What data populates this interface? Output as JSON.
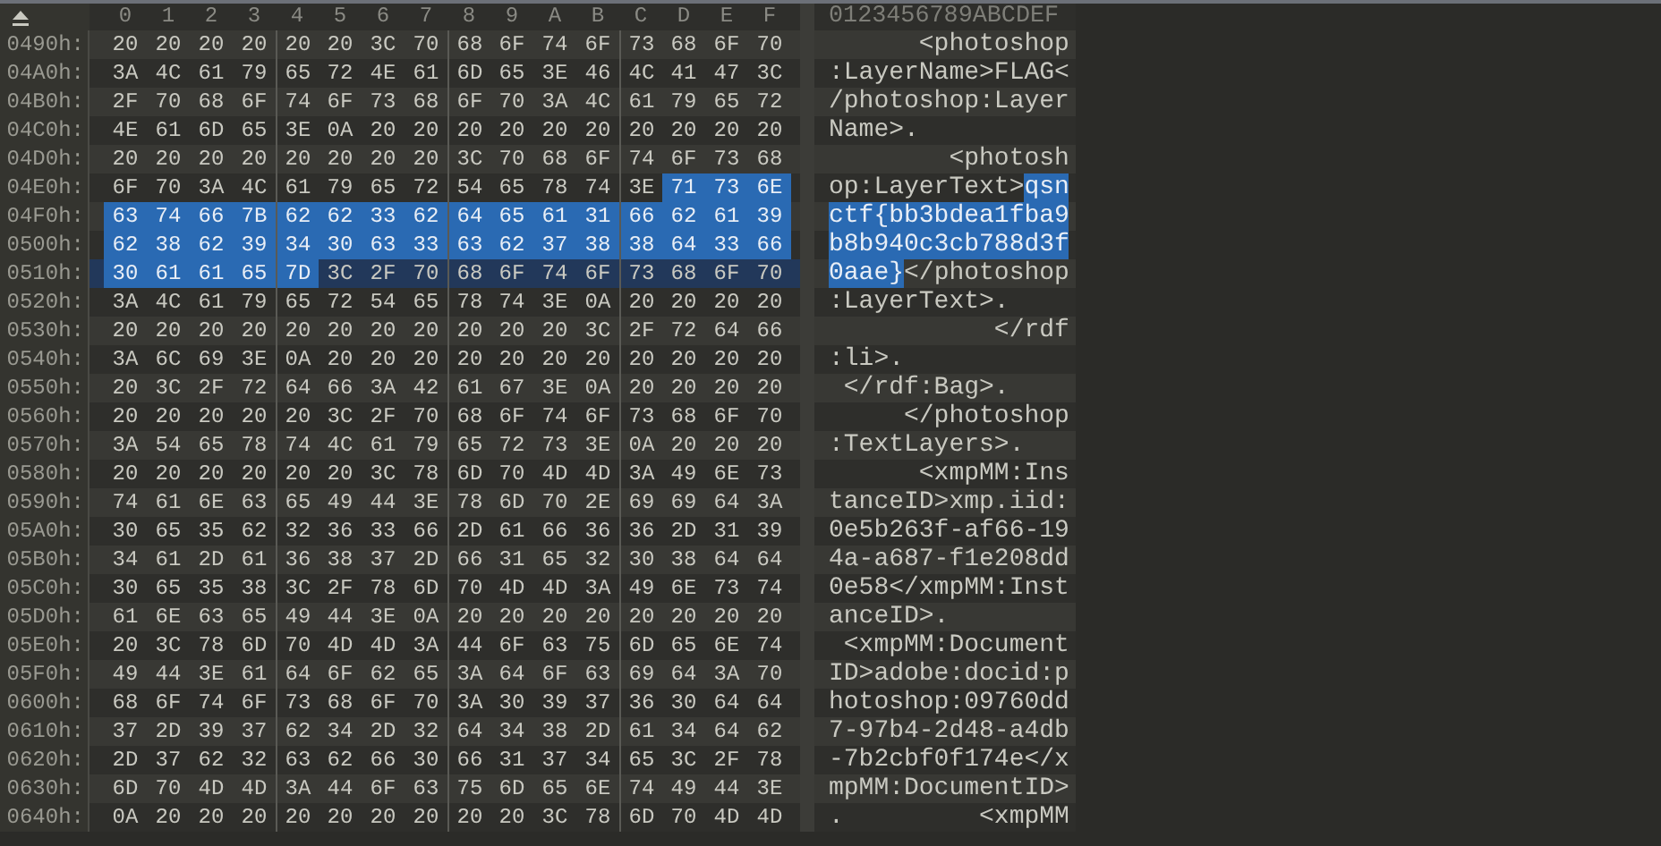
{
  "header": {
    "hex_columns": [
      "0",
      "1",
      "2",
      "3",
      "4",
      "5",
      "6",
      "7",
      "8",
      "9",
      "A",
      "B",
      "C",
      "D",
      "E",
      "F"
    ],
    "ascii_ruler": "0123456789ABCDEF"
  },
  "rows": [
    {
      "offset": "0490h:",
      "current": false,
      "hex": [
        {
          "bytes": "20 20 20 20 20 20 3C 70 68 6F 74 6F 73 68 6F 70",
          "selected": false
        }
      ],
      "ascii": [
        {
          "text": "      <photoshop",
          "selected": false
        }
      ]
    },
    {
      "offset": "04A0h:",
      "current": false,
      "hex": [
        {
          "bytes": "3A 4C 61 79 65 72 4E 61 6D 65 3E 46 4C 41 47 3C",
          "selected": false
        }
      ],
      "ascii": [
        {
          "text": ":LayerName>FLAG<",
          "selected": false
        }
      ]
    },
    {
      "offset": "04B0h:",
      "current": false,
      "hex": [
        {
          "bytes": "2F 70 68 6F 74 6F 73 68 6F 70 3A 4C 61 79 65 72",
          "selected": false
        }
      ],
      "ascii": [
        {
          "text": "/photoshop:Layer",
          "selected": false
        }
      ]
    },
    {
      "offset": "04C0h:",
      "current": false,
      "hex": [
        {
          "bytes": "4E 61 6D 65 3E 0A 20 20 20 20 20 20 20 20 20 20",
          "selected": false
        }
      ],
      "ascii": [
        {
          "text": "Name>.",
          "selected": false
        }
      ]
    },
    {
      "offset": "04D0h:",
      "current": false,
      "hex": [
        {
          "bytes": "20 20 20 20 20 20 20 20 3C 70 68 6F 74 6F 73 68",
          "selected": false
        }
      ],
      "ascii": [
        {
          "text": "        <photosh",
          "selected": false
        }
      ]
    },
    {
      "offset": "04E0h:",
      "current": false,
      "hex": [
        {
          "bytes": "6F 70 3A 4C 61 79 65 72 54 65 78 74 3E",
          "selected": false
        },
        {
          "bytes": "71 73 6E",
          "selected": true
        }
      ],
      "ascii": [
        {
          "text": "op:LayerText>",
          "selected": false
        },
        {
          "text": "qsn",
          "selected": true
        }
      ]
    },
    {
      "offset": "04F0h:",
      "current": false,
      "hex": [
        {
          "bytes": "63 74 66 7B 62 62 33 62 64 65 61 31 66 62 61 39",
          "selected": true
        }
      ],
      "ascii": [
        {
          "text": "ctf{bb3bdea1fba9",
          "selected": true
        }
      ]
    },
    {
      "offset": "0500h:",
      "current": false,
      "hex": [
        {
          "bytes": "62 38 62 39 34 30 63 33 63 62 37 38 38 64 33 66",
          "selected": true
        }
      ],
      "ascii": [
        {
          "text": "b8b940c3cb788d3f",
          "selected": true
        }
      ]
    },
    {
      "offset": "0510h:",
      "current": true,
      "hex": [
        {
          "bytes": "30 61 61 65 7D",
          "selected": true
        },
        {
          "bytes": "3C 2F 70 68 6F 74 6F 73 68 6F 70",
          "selected": false
        }
      ],
      "ascii": [
        {
          "text": "0aae}",
          "selected": true
        },
        {
          "text": "</photoshop",
          "selected": false
        }
      ]
    },
    {
      "offset": "0520h:",
      "current": false,
      "hex": [
        {
          "bytes": "3A 4C 61 79 65 72 54 65 78 74 3E 0A 20 20 20 20",
          "selected": false
        }
      ],
      "ascii": [
        {
          "text": ":LayerText>.",
          "selected": false
        }
      ]
    },
    {
      "offset": "0530h:",
      "current": false,
      "hex": [
        {
          "bytes": "20 20 20 20 20 20 20 20 20 20 20 3C 2F 72 64 66",
          "selected": false
        }
      ],
      "ascii": [
        {
          "text": "           </rdf",
          "selected": false
        }
      ]
    },
    {
      "offset": "0540h:",
      "current": false,
      "hex": [
        {
          "bytes": "3A 6C 69 3E 0A 20 20 20 20 20 20 20 20 20 20 20",
          "selected": false
        }
      ],
      "ascii": [
        {
          "text": ":li>.",
          "selected": false
        }
      ]
    },
    {
      "offset": "0550h:",
      "current": false,
      "hex": [
        {
          "bytes": "20 3C 2F 72 64 66 3A 42 61 67 3E 0A 20 20 20 20",
          "selected": false
        }
      ],
      "ascii": [
        {
          "text": " </rdf:Bag>.",
          "selected": false
        }
      ]
    },
    {
      "offset": "0560h:",
      "current": false,
      "hex": [
        {
          "bytes": "20 20 20 20 20 3C 2F 70 68 6F 74 6F 73 68 6F 70",
          "selected": false
        }
      ],
      "ascii": [
        {
          "text": "     </photoshop",
          "selected": false
        }
      ]
    },
    {
      "offset": "0570h:",
      "current": false,
      "hex": [
        {
          "bytes": "3A 54 65 78 74 4C 61 79 65 72 73 3E 0A 20 20 20",
          "selected": false
        }
      ],
      "ascii": [
        {
          "text": ":TextLayers>.",
          "selected": false
        }
      ]
    },
    {
      "offset": "0580h:",
      "current": false,
      "hex": [
        {
          "bytes": "20 20 20 20 20 20 3C 78 6D 70 4D 4D 3A 49 6E 73",
          "selected": false
        }
      ],
      "ascii": [
        {
          "text": "      <xmpMM:Ins",
          "selected": false
        }
      ]
    },
    {
      "offset": "0590h:",
      "current": false,
      "hex": [
        {
          "bytes": "74 61 6E 63 65 49 44 3E 78 6D 70 2E 69 69 64 3A",
          "selected": false
        }
      ],
      "ascii": [
        {
          "text": "tanceID>xmp.iid:",
          "selected": false
        }
      ]
    },
    {
      "offset": "05A0h:",
      "current": false,
      "hex": [
        {
          "bytes": "30 65 35 62 32 36 33 66 2D 61 66 36 36 2D 31 39",
          "selected": false
        }
      ],
      "ascii": [
        {
          "text": "0e5b263f-af66-19",
          "selected": false
        }
      ]
    },
    {
      "offset": "05B0h:",
      "current": false,
      "hex": [
        {
          "bytes": "34 61 2D 61 36 38 37 2D 66 31 65 32 30 38 64 64",
          "selected": false
        }
      ],
      "ascii": [
        {
          "text": "4a-a687-f1e208dd",
          "selected": false
        }
      ]
    },
    {
      "offset": "05C0h:",
      "current": false,
      "hex": [
        {
          "bytes": "30 65 35 38 3C 2F 78 6D 70 4D 4D 3A 49 6E 73 74",
          "selected": false
        }
      ],
      "ascii": [
        {
          "text": "0e58</xmpMM:Inst",
          "selected": false
        }
      ]
    },
    {
      "offset": "05D0h:",
      "current": false,
      "hex": [
        {
          "bytes": "61 6E 63 65 49 44 3E 0A 20 20 20 20 20 20 20 20",
          "selected": false
        }
      ],
      "ascii": [
        {
          "text": "anceID>.",
          "selected": false
        }
      ]
    },
    {
      "offset": "05E0h:",
      "current": false,
      "hex": [
        {
          "bytes": "20 3C 78 6D 70 4D 4D 3A 44 6F 63 75 6D 65 6E 74",
          "selected": false
        }
      ],
      "ascii": [
        {
          "text": " <xmpMM:Document",
          "selected": false
        }
      ]
    },
    {
      "offset": "05F0h:",
      "current": false,
      "hex": [
        {
          "bytes": "49 44 3E 61 64 6F 62 65 3A 64 6F 63 69 64 3A 70",
          "selected": false
        }
      ],
      "ascii": [
        {
          "text": "ID>adobe:docid:p",
          "selected": false
        }
      ]
    },
    {
      "offset": "0600h:",
      "current": false,
      "hex": [
        {
          "bytes": "68 6F 74 6F 73 68 6F 70 3A 30 39 37 36 30 64 64",
          "selected": false
        }
      ],
      "ascii": [
        {
          "text": "hotoshop:09760dd",
          "selected": false
        }
      ]
    },
    {
      "offset": "0610h:",
      "current": false,
      "hex": [
        {
          "bytes": "37 2D 39 37 62 34 2D 32 64 34 38 2D 61 34 64 62",
          "selected": false
        }
      ],
      "ascii": [
        {
          "text": "7-97b4-2d48-a4db",
          "selected": false
        }
      ]
    },
    {
      "offset": "0620h:",
      "current": false,
      "hex": [
        {
          "bytes": "2D 37 62 32 63 62 66 30 66 31 37 34 65 3C 2F 78",
          "selected": false
        }
      ],
      "ascii": [
        {
          "text": "-7b2cbf0f174e</x",
          "selected": false
        }
      ]
    },
    {
      "offset": "0630h:",
      "current": false,
      "hex": [
        {
          "bytes": "6D 70 4D 4D 3A 44 6F 63 75 6D 65 6E 74 49 44 3E",
          "selected": false
        }
      ],
      "ascii": [
        {
          "text": "mpMM:DocumentID>",
          "selected": false
        }
      ]
    },
    {
      "offset": "0640h:",
      "current": false,
      "hex": [
        {
          "bytes": "0A 20 20 20 20 20 20 20 20 20 3C 78 6D 70 4D 4D",
          "selected": false
        }
      ],
      "ascii": [
        {
          "text": ".         <xmpMM",
          "selected": false
        }
      ]
    }
  ]
}
